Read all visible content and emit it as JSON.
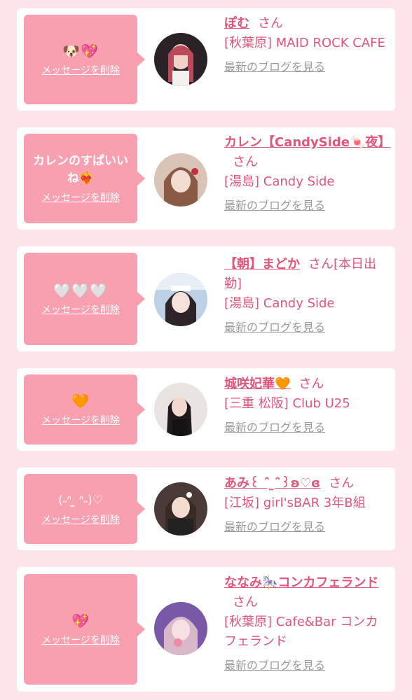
{
  "items": [
    {
      "message": "🐶💖",
      "delete_label": "メッセージを削除",
      "name": "ぽむ",
      "suffix": "さん",
      "shop": "[秋葉原] MAID ROCK CAFE",
      "blog_label": "最新のブログを見る"
    },
    {
      "message": "カレンのすぱいいね❤️‍🔥",
      "delete_label": "メッセージを削除",
      "name": "カレン【CandySide🍬夜】",
      "suffix": "さん",
      "shop": "[湯島] Candy Side",
      "blog_label": "最新のブログを見る"
    },
    {
      "message": "🤍🤍🤍",
      "delete_label": "メッセージを削除",
      "name": "【朝】まどか",
      "suffix": "さん[本日出勤]",
      "shop": "[湯島] Candy Side",
      "blog_label": "最新のブログを見る"
    },
    {
      "message": "🧡",
      "delete_label": "メッセージを削除",
      "name": "城咲妃華🧡",
      "suffix": "さん",
      "shop": "[三重 松阪] Club U25",
      "blog_label": "最新のブログを見る"
    },
    {
      "message": "(˶ᐢ ̫ ᐢ˶)♡",
      "delete_label": "メッセージを削除",
      "name": "あみ꒰ ˆ̑ ̫ˆ̑꒱ʚ♡ɞ",
      "suffix": "さん",
      "shop": "[江坂] girl'sBAR 3年B組",
      "blog_label": "最新のブログを見る"
    },
    {
      "message": "💖",
      "delete_label": "メッセージを削除",
      "name": "ななみ🎠コンカフェランド",
      "suffix": "さん",
      "shop": "[秋葉原] Cafe&Bar コンカフェランド",
      "blog_label": "最新のブログを見る"
    }
  ],
  "colors": {
    "page_bg": "#fce4ea",
    "bubble": "#f9a0b0",
    "accent": "#e0567a",
    "muted": "#999999"
  }
}
